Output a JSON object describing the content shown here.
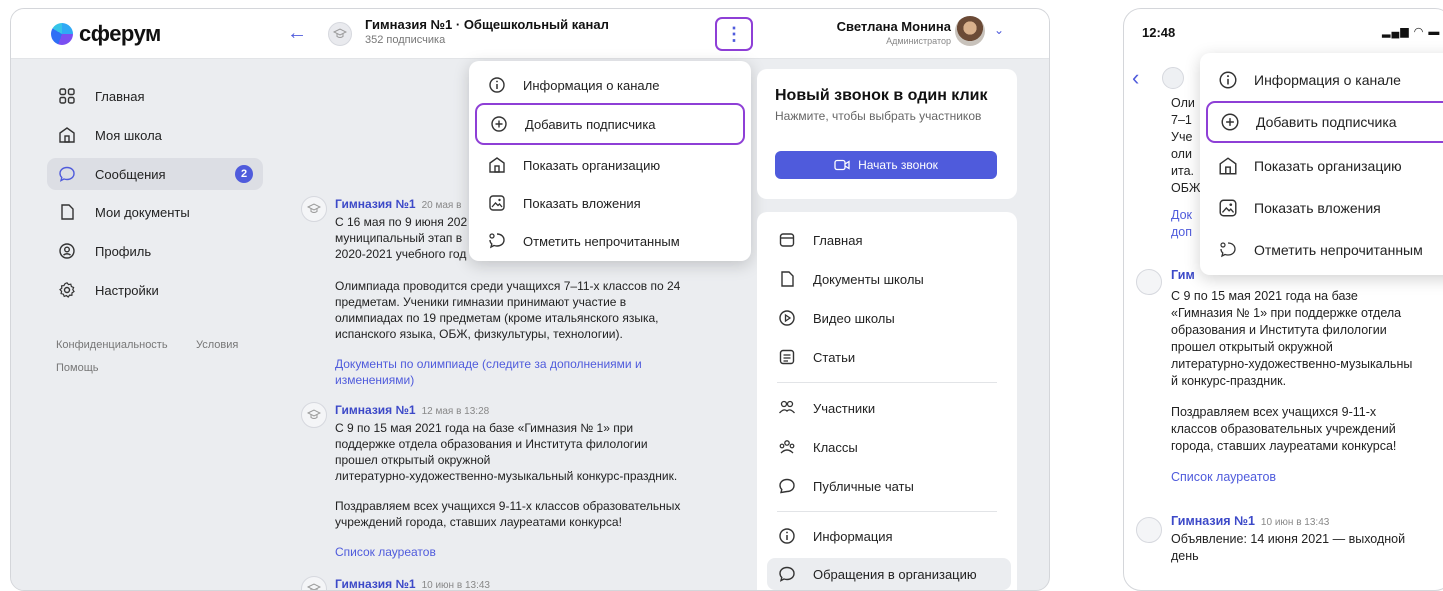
{
  "desktop": {
    "logo": "сферум",
    "channel": {
      "title": "Гимназия №1 · Общешкольный канал",
      "subtitle": "352 подписчика"
    },
    "kebab": "⋮",
    "user": {
      "name": "Светлана Монина",
      "role": "Администратор"
    },
    "nav": {
      "items": [
        {
          "label": "Главная",
          "icon": "grid-icon"
        },
        {
          "label": "Моя школа",
          "icon": "school-icon"
        },
        {
          "label": "Сообщения",
          "icon": "chat-icon",
          "badge": "2"
        },
        {
          "label": "Мои документы",
          "icon": "document-icon"
        },
        {
          "label": "Профиль",
          "icon": "profile-icon"
        },
        {
          "label": "Настройки",
          "icon": "gear-icon"
        }
      ],
      "footer": {
        "privacy": "Конфиденциальность",
        "terms": "Условия",
        "help": "Помощь"
      }
    },
    "posts": [
      {
        "author": "Гимназия №1",
        "time": "20 мая в",
        "lines1": [
          "С 16 мая по 9 июня 202",
          "муниципальный этап в",
          "2020-2021 учебного год"
        ],
        "lines2": [
          "Олимпиада проводится среди учащихся 7–11-х классов по 24",
          "предметам. Ученики гимназии принимают участие в",
          "олимпиадах по 19 предметам (кроме итальянского языка,",
          "испанского языка, ОБЖ, физкультуры, технологии)."
        ],
        "link": [
          "Документы по олимпиаде (следите за дополнениями и",
          "изменениями)"
        ]
      },
      {
        "author": "Гимназия №1",
        "time": "12 мая в 13:28",
        "lines1": [
          "С 9 по 15 мая 2021 года на базе «Гимназия № 1» при",
          "поддержке отдела образования и Института филологии",
          "прошел открытый окружной",
          "литературно-художественно-музыкальный конкурс-праздник."
        ],
        "lines2": [
          "Поздравляем всех учащихся 9-11-х классов образовательных",
          "учреждений города, ставших лауреатами конкурса!"
        ],
        "link": [
          "Список лауреатов"
        ]
      },
      {
        "author": "Гимназия №1",
        "time": "10 июн в 13:43"
      }
    ],
    "dropdown": [
      {
        "label": "Информация о канале",
        "icon": "info-icon"
      },
      {
        "label": "Добавить подписчика",
        "icon": "add-circle-icon"
      },
      {
        "label": "Показать организацию",
        "icon": "school-icon"
      },
      {
        "label": "Показать вложения",
        "icon": "image-icon"
      },
      {
        "label": "Отметить непрочитанным",
        "icon": "unread-chat-icon"
      }
    ],
    "call_card": {
      "title": "Новый звонок в один клик",
      "subtitle": "Нажмите, чтобы выбрать участников",
      "button": "Начать звонок"
    },
    "channel_menu": [
      {
        "label": "Главная",
        "icon": "home-icon"
      },
      {
        "label": "Документы школы",
        "icon": "document-icon"
      },
      {
        "label": "Видео школы",
        "icon": "play-icon"
      },
      {
        "label": "Статьи",
        "icon": "article-icon"
      },
      {
        "label": "Участники",
        "icon": "people-icon"
      },
      {
        "label": "Классы",
        "icon": "classes-icon"
      },
      {
        "label": "Публичные чаты",
        "icon": "public-chat-icon"
      },
      {
        "label": "Информация",
        "icon": "info-icon"
      },
      {
        "label": "Обращения в организацию",
        "icon": "chat-icon"
      }
    ]
  },
  "mobile": {
    "time": "12:48",
    "status": "▂▄▆ ◠ ▬",
    "peek_lines": [
      "Оли",
      "7–1",
      "Уче",
      "оли",
      "ита.",
      "ОБЖ"
    ],
    "peek_link": [
      "Док",
      "доп"
    ],
    "peek_author": "Гим",
    "dropdown": [
      {
        "label": "Информация о канале",
        "icon": "info-icon"
      },
      {
        "label": "Добавить подписчика",
        "icon": "add-circle-icon"
      },
      {
        "label": "Показать организацию",
        "icon": "school-icon"
      },
      {
        "label": "Показать вложения",
        "icon": "image-icon"
      },
      {
        "label": "Отметить непрочитанным",
        "icon": "unread-chat-icon"
      }
    ],
    "post1": {
      "lines1": [
        "С 9 по 15 мая 2021 года на базе",
        "«Гимназия № 1» при поддержке отдела",
        "образования и Института филологии",
        "прошел открытый окружной",
        "литературно-художественно-музыкальны",
        "й конкурс-праздник."
      ],
      "lines2": [
        "Поздравляем всех учащихся 9-11-х",
        "классов образовательных учреждений",
        "города, ставших лауреатами конкурса!"
      ],
      "link": "Список лауреатов"
    },
    "post2": {
      "author": "Гимназия №1",
      "time": "10 июн в 13:43",
      "lines": [
        "Объявление: 14 июня 2021 — выходной",
        "день"
      ]
    }
  },
  "colors": {
    "accent": "#4f5bdc",
    "highlight": "#8e3fd6",
    "badge": "#4f5bdc",
    "link": "#4f5bdc"
  }
}
